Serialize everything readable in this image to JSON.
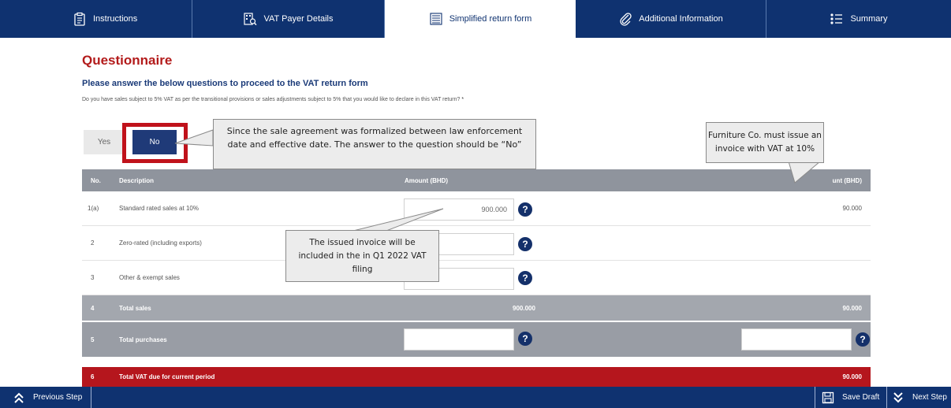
{
  "tabs": [
    {
      "label": "Instructions",
      "icon": "clipboard-icon"
    },
    {
      "label": "VAT Payer Details",
      "icon": "building-search-icon"
    },
    {
      "label": "Simplified return form",
      "icon": "list-icon"
    },
    {
      "label": "Additional Information",
      "icon": "paperclip-icon"
    },
    {
      "label": "Summary",
      "icon": "summary-list-icon"
    }
  ],
  "heading": "Questionnaire",
  "subheading": "Please answer the below questions to proceed to the VAT return form",
  "question": {
    "text": "Do you have sales subject to 5% VAT as per the transitional provisions or sales adjustments subject to 5% that you would like to declare in this VAT return?",
    "required_mark": "*",
    "yes_label": "Yes",
    "no_label": "No",
    "selected": "No"
  },
  "table": {
    "headers": {
      "no": "No.",
      "description": "Description",
      "amount": "Amount (BHD)",
      "vat_amount": "VAT amount (BHD)",
      "vat_amount_visible": "unt (BHD)"
    },
    "rows": [
      {
        "no": "1(a)",
        "description": "Standard rated sales at 10%",
        "amount": "900.000",
        "vat": "90.000"
      },
      {
        "no": "2",
        "description": "Zero-rated (including exports)",
        "amount": "",
        "vat": ""
      },
      {
        "no": "3",
        "description": "Other & exempt sales",
        "amount": "",
        "vat": ""
      },
      {
        "no": "4",
        "description": "Total sales",
        "amount": "900.000",
        "vat": "90.000"
      },
      {
        "no": "5",
        "description": "Total purchases",
        "amount": "",
        "vat": ""
      },
      {
        "no": "6",
        "description": "Total VAT due for current period",
        "amount": "",
        "vat": "90.000"
      }
    ]
  },
  "callouts": {
    "agreement": {
      "line1": "Since the sale agreement was formalized between law enforcement",
      "line2": "date and effective date. The answer to the question  should be “No”"
    },
    "furniture": {
      "line1": "Furniture Co. must issue an",
      "line2": "invoice with VAT at 10%"
    },
    "invoice": {
      "line1": "The issued invoice will be",
      "line2": "included in the in Q1 2022 VAT",
      "line3": "filing"
    }
  },
  "footer": {
    "previous_label": "Previous Step",
    "save_label": "Save Draft",
    "next_label": "Next Step"
  },
  "colors": {
    "navy": "#0f3270",
    "accent_red": "#b31b1b",
    "table_header": "#8f949d",
    "total_row": "#a3a7ae",
    "due_row": "#b5161d"
  }
}
